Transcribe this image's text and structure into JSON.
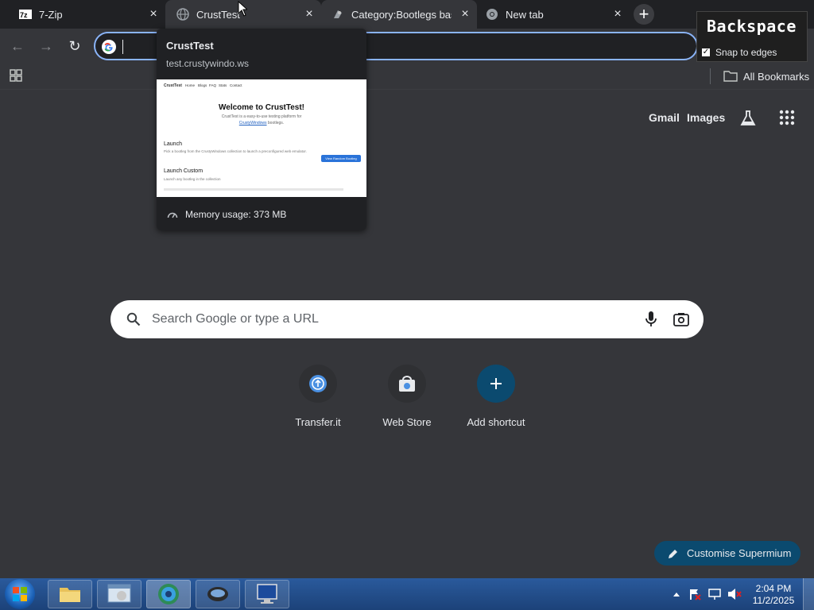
{
  "tabs": [
    {
      "title": "7-Zip",
      "icon": "7zip-icon",
      "active": false
    },
    {
      "title": "CrustTest",
      "icon": "globe-icon",
      "active": true
    },
    {
      "title": "Category:Bootlegs base",
      "icon": "bootleg-icon",
      "active": false
    },
    {
      "title": "New tab",
      "icon": "chrome-icon",
      "active": false
    }
  ],
  "tab_close_glyph": "×",
  "newtab_glyph": "+",
  "toolbar": {
    "back_glyph": "←",
    "forward_glyph": "→",
    "reload_glyph": "↻",
    "omnibox_value": ""
  },
  "bookmarks_bar": {
    "all_bookmarks_label": "All Bookmarks"
  },
  "overlay": {
    "title": "Backspace",
    "snap_label": "Snap to edges",
    "snap_checked": true
  },
  "hover_card": {
    "title": "CrustTest",
    "domain": "test.crustywindo.ws",
    "memory": "Memory usage: 373 MB",
    "preview": {
      "header_brand": "CrustTest",
      "nav": [
        "Home",
        "Blogs",
        "FAQ",
        "Stats",
        "Contact"
      ],
      "heading": "Welcome to CrustTest!",
      "intro": "CrustTest is a easy-to-use testing platform for",
      "intro_link": "CrustyWindows",
      "intro_end": "bootlegs.",
      "launch_heading": "Launch",
      "launch_text": "Pick a bootleg from the CrustyWindows collection to launch a preconfigured web emulator.",
      "launch_button": "View Random Bootleg",
      "custom_heading": "Launch Custom",
      "custom_text": "Launch any bootleg in the collection"
    }
  },
  "ntp": {
    "gmail": "Gmail",
    "images": "Images",
    "search_placeholder": "Search Google or type a URL",
    "shortcuts": [
      {
        "label": "Transfer.it",
        "icon": "transfer-icon"
      },
      {
        "label": "Web Store",
        "icon": "webstore-icon"
      },
      {
        "label": "Add shortcut",
        "icon": "plus-icon"
      }
    ],
    "customise_label": "Customise Supermium"
  },
  "taskbar": {
    "time": "2:04 PM",
    "date": "11/2/2025"
  },
  "colors": {
    "accent": "#8ab4f8",
    "background": "#35363a",
    "tabstrip": "#202124",
    "customise_bg": "#0b4a6f",
    "add_shortcut_bg": "#0b4a6f"
  }
}
